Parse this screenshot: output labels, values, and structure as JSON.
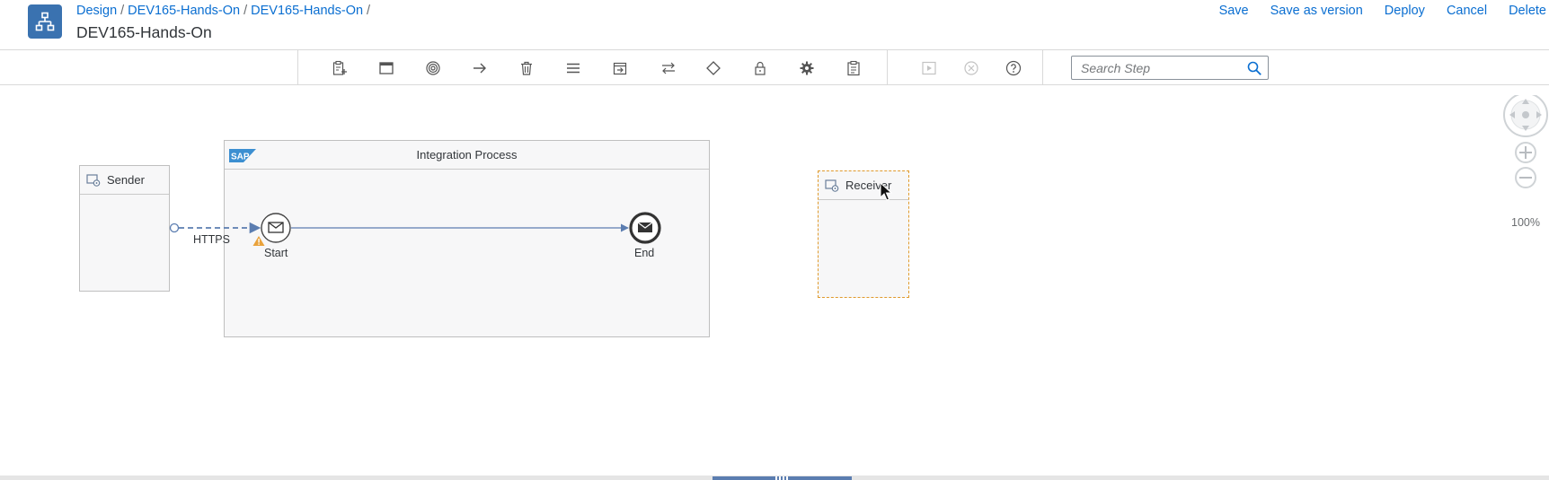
{
  "header": {
    "breadcrumb": [
      "Design",
      "DEV165-Hands-On",
      "DEV165-Hands-On"
    ],
    "breadcrumb_separator": "/",
    "title": "DEV165-Hands-On",
    "actions": {
      "save": "Save",
      "save_as_version": "Save as version",
      "deploy": "Deploy",
      "cancel": "Cancel",
      "delete": "Delete"
    }
  },
  "toolbar": {
    "tools": [
      "add-participant-icon",
      "window-icon",
      "target-icon",
      "arrow-right-icon",
      "trash-icon",
      "menu-icon",
      "exit-icon",
      "swap-icon",
      "diamond-icon",
      "lock-icon",
      "gear-icon",
      "clipboard-icon"
    ],
    "debug_tools": [
      "play-icon",
      "stop-icon",
      "help-icon"
    ],
    "search": {
      "placeholder": "Search Step"
    }
  },
  "canvas": {
    "sender": {
      "label": "Sender"
    },
    "receiver": {
      "label": "Receiver"
    },
    "process": {
      "title": "Integration Process",
      "logo_text": "SAP"
    },
    "start_event": {
      "label": "Start"
    },
    "end_event": {
      "label": "End"
    },
    "connection": {
      "label": "HTTPS"
    },
    "zoom": {
      "level": "100%"
    }
  },
  "colors": {
    "brand": "#3a72b0",
    "link": "#0a6ed1",
    "selection": "#e09a2c",
    "warning": "#e9a23b",
    "flow": "#5b7db0"
  }
}
